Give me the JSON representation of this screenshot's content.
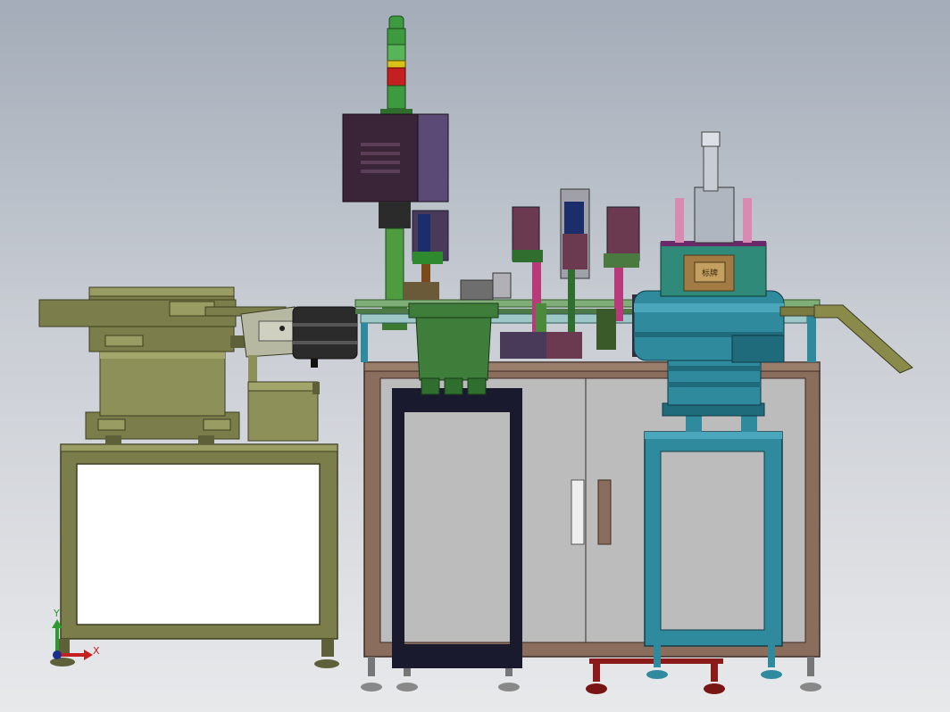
{
  "viewport": {
    "kind": "cad-3d-model-front-view",
    "background_top": "#a3acb8",
    "background_bottom": "#e8e9eb"
  },
  "machine": {
    "components": [
      "left-vibratory-bowl-feeder",
      "left-feeder-stand",
      "linear-feeder",
      "main-cabinet",
      "signal-tower",
      "electrical-box",
      "assembly-stations",
      "green-hopper",
      "right-vibratory-bowl-feeder",
      "right-feeder-stand",
      "discharge-chute"
    ],
    "plate_text": "标牌",
    "colors": {
      "olive": "#7b7e4a",
      "olive_light": "#9a9d63",
      "cabinet": "#8a6d5c",
      "panel": "#bcbcbc",
      "teal": "#2f8a9e",
      "green": "#3f7d3a",
      "purple": "#3a2438",
      "tower_green": "#3e9a3e",
      "tower_yellow": "#d9c21a",
      "tower_red": "#c42020"
    }
  },
  "triad": {
    "x_label": "X",
    "y_label": "Y",
    "x_icon": "x-axis-arrow-icon",
    "y_icon": "y-axis-arrow-icon"
  }
}
